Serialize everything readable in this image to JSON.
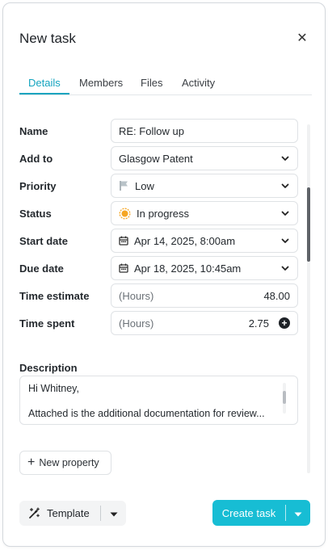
{
  "dialog": {
    "title": "New task",
    "close_icon": "close-icon"
  },
  "tabs": [
    {
      "label": "Details",
      "active": true
    },
    {
      "label": "Members",
      "active": false
    },
    {
      "label": "Files",
      "active": false
    },
    {
      "label": "Activity",
      "active": false
    }
  ],
  "fields": {
    "name": {
      "label": "Name",
      "value": "RE: Follow up"
    },
    "add_to": {
      "label": "Add to",
      "value": "Glasgow Patent"
    },
    "priority": {
      "label": "Priority",
      "value": "Low",
      "icon": "flag-icon"
    },
    "status": {
      "label": "Status",
      "value": "In progress",
      "icon": "in-progress-sun-icon"
    },
    "start_date": {
      "label": "Start date",
      "value": "Apr 14, 2025, 8:00am",
      "icon": "calendar-icon"
    },
    "due_date": {
      "label": "Due date",
      "value": "Apr 18, 2025, 10:45am",
      "icon": "calendar-icon"
    },
    "time_estimate": {
      "label": "Time estimate",
      "placeholder": "(Hours)",
      "value": "48.00"
    },
    "time_spent": {
      "label": "Time spent",
      "placeholder": "(Hours)",
      "value": "2.75",
      "icon": "add-circle-icon"
    }
  },
  "description": {
    "label": "Description",
    "line1": "Hi Whitney,",
    "line2": "Attached is the additional documentation for review..."
  },
  "new_property": {
    "label": "New property",
    "icon": "plus-icon"
  },
  "footer": {
    "template_label": "Template",
    "template_icon": "magic-wand-icon",
    "create_label": "Create task"
  },
  "colors": {
    "accent": "#14a4bf",
    "create_button": "#17bdd4",
    "status_icon": "#f5a623"
  }
}
